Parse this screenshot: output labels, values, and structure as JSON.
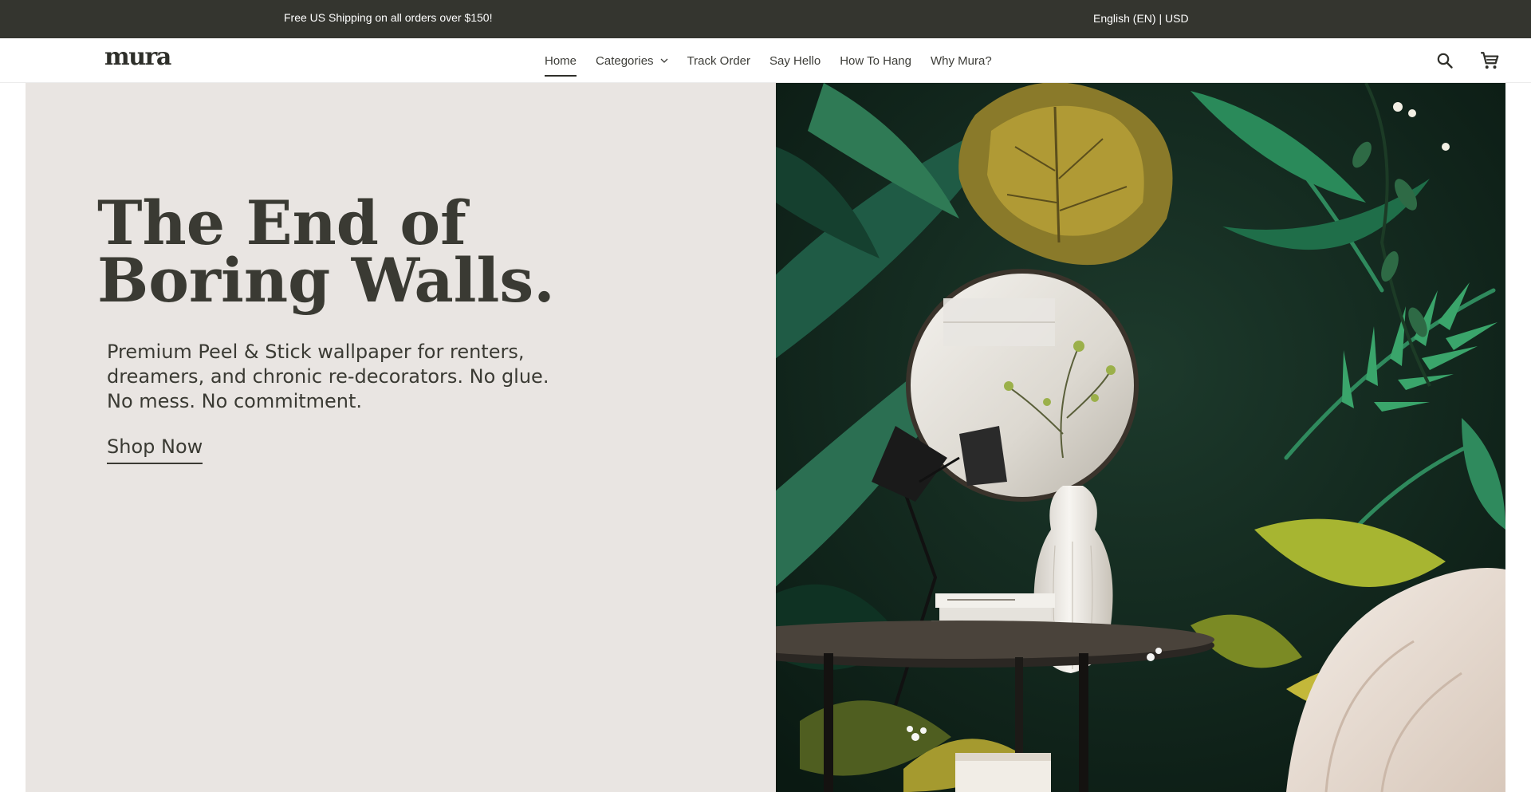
{
  "announcement": {
    "left_glyph": "",
    "text": "Free US Shipping on all orders over $150!",
    "right_glyph": "",
    "locale": "English (EN) | USD"
  },
  "header": {
    "logo_text": "mura",
    "nav": [
      {
        "label": "Home",
        "active": true
      },
      {
        "label": "Categories",
        "has_dropdown": true,
        "icon": "chevron-down-icon"
      },
      {
        "label": "Track Order"
      },
      {
        "label": "Say Hello"
      },
      {
        "label": "How To Hang"
      },
      {
        "label": "Why Mura?"
      }
    ],
    "icons": [
      "search-icon",
      "cart-icon"
    ]
  },
  "hero": {
    "title": "The End of Boring Walls.",
    "subtitle": "Premium Peel & Stick wallpaper for renters, dreamers, and chronic re-decorators. No glue. No mess. No commitment.",
    "cta_label": "Shop Now",
    "background_color": "#e9e5e2",
    "image": "tropical-leaf-wallpaper-with-round-mirror-lamp-and-vase"
  },
  "colors": {
    "announcement_bg": "#34352f",
    "text_dark": "#3a3a33",
    "hero_bg": "#e9e5e2"
  }
}
